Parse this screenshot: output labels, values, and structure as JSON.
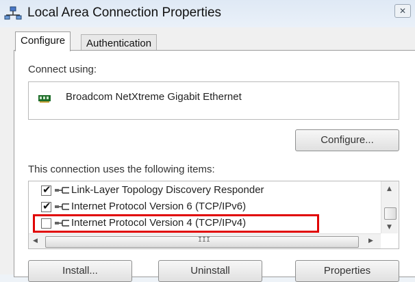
{
  "window": {
    "title": "Local Area Connection Properties",
    "close_glyph": "✕"
  },
  "tabs": [
    {
      "label": "Configure",
      "active": true
    },
    {
      "label": "Authentication",
      "active": false
    }
  ],
  "connect_using": {
    "label": "Connect using:",
    "adapter_name": "Broadcom NetXtreme Gigabit Ethernet",
    "adapter_icon": "network-adapter-icon"
  },
  "buttons": {
    "configure": "Configure...",
    "install": "Install...",
    "uninstall": "Uninstall",
    "properties": "Properties"
  },
  "items_label": "This connection uses the following items:",
  "items": [
    {
      "label": "Link-Layer Topology Discovery Responder",
      "checked": true,
      "icon": "network-protocol-icon"
    },
    {
      "label": "Internet Protocol Version 6 (TCP/IPv6)",
      "checked": true,
      "icon": "network-protocol-icon"
    },
    {
      "label": "Internet Protocol Version 4 (TCP/IPv4)",
      "checked": false,
      "icon": "network-protocol-icon",
      "highlighted": true
    }
  ],
  "scrollbar": {
    "up": "▲",
    "down": "▼",
    "left": "◀",
    "right": "▶",
    "grip": "III"
  },
  "colors": {
    "highlight": "#e00000"
  }
}
